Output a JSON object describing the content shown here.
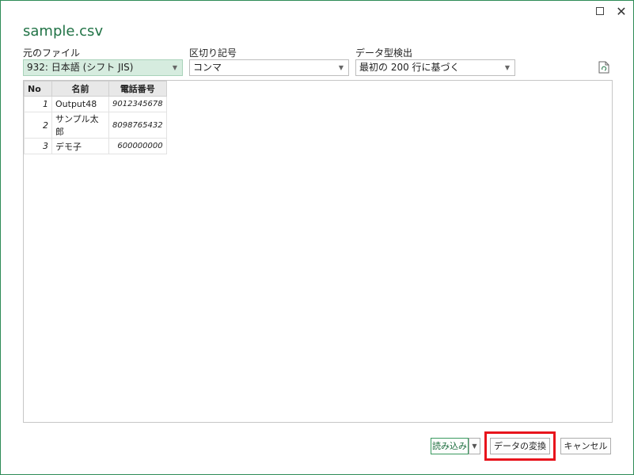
{
  "window": {
    "title": "sample.csv",
    "maximize_icon": "maximize-icon",
    "close_icon": "close-icon",
    "close_glyph": "✕"
  },
  "fields": {
    "file_origin": {
      "label": "元のファイル",
      "value": "932: 日本語 (シフト JIS)"
    },
    "delimiter": {
      "label": "区切り記号",
      "value": "コンマ"
    },
    "data_type_detection": {
      "label": "データ型検出",
      "value": "最初の 200 行に基づく"
    }
  },
  "preview": {
    "columns": [
      "No",
      "名前",
      "電話番号"
    ],
    "rows": [
      [
        "1",
        "Output48",
        "9012345678"
      ],
      [
        "2",
        "サンプル太郎",
        "8098765432"
      ],
      [
        "3",
        "デモ子",
        "600000000"
      ]
    ]
  },
  "buttons": {
    "load": "読み込み",
    "transform": "データの変換",
    "cancel": "キャンセル"
  },
  "colors": {
    "accent": "#217346",
    "highlight": "#e8141c",
    "selected_bg": "#d6ecdf"
  }
}
